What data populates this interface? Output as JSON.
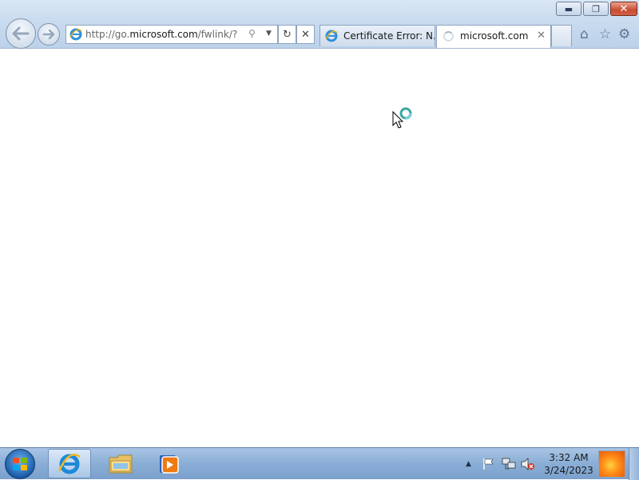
{
  "browser": {
    "address_url_prefix": "http://go.",
    "address_url_domain": "microsoft.com",
    "address_url_suffix": "/fwlink/?LinkI",
    "tabs": [
      {
        "label": "Certificate Error: N...",
        "icon": "ie-icon",
        "active": false
      },
      {
        "label": "microsoft.com",
        "icon": "loading-spinner-icon",
        "active": true
      }
    ],
    "window_controls": [
      "minimize-icon",
      "restore-icon",
      "close-icon"
    ],
    "command_icons": [
      "home-icon",
      "favorites-star-icon",
      "tools-gear-icon"
    ]
  },
  "taskbar": {
    "pinned": [
      "internet-explorer-icon",
      "windows-explorer-icon",
      "media-player-icon"
    ],
    "clock_time": "3:32 AM",
    "clock_date": "3/24/2023"
  },
  "colors": {
    "titlebar": "#c9dbef",
    "taskbar": "#8aaed6",
    "close_button": "#c74c32"
  }
}
